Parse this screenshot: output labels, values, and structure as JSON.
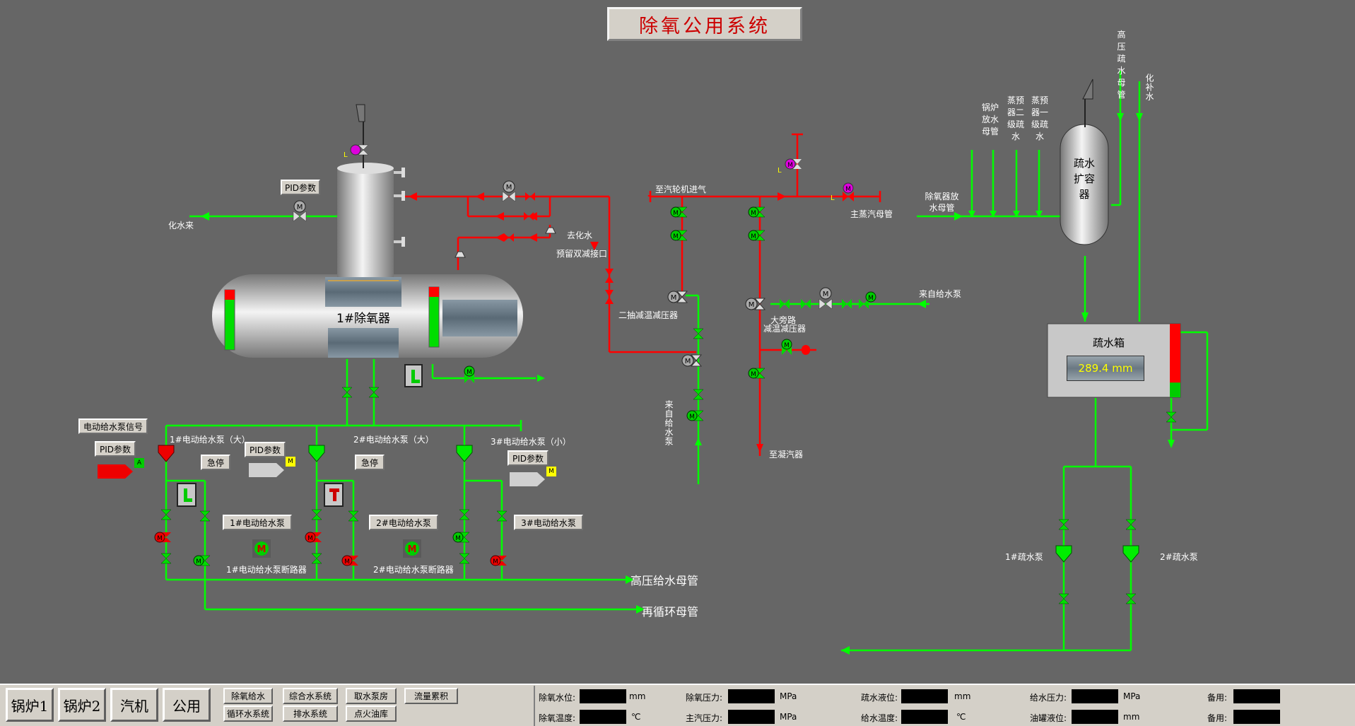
{
  "title": "除氧公用系统",
  "deaerator": {
    "name": "1#除氧器"
  },
  "tank": {
    "name": "疏水箱",
    "level": "289.4 mm"
  },
  "expander": {
    "name": "疏水扩容器"
  },
  "labels": {
    "chem_water_in": "化水来",
    "to_chem_water": "去化水",
    "reserved_port": "预留双减接口",
    "to_turbine_steam": "至汽轮机进气",
    "main_steam_header": "主蒸汽母管",
    "second_extraction": "二抽减温减压器",
    "from_feed_pump_right": "来自给水泵",
    "from_feed_pump_vertical": "来自给水泵",
    "large_bypass_1": "大旁路",
    "large_bypass_2": "减温减压器",
    "to_condenser": "至凝汽器",
    "hp_drain_header": "高压疏水母管",
    "chem_makeup": "化补水",
    "boiler_blowdown": "锅炉放水母管",
    "preheat2": "蒸预器二级疏水",
    "preheat1": "蒸预器一级疏水",
    "deaerator_drain": "除氧器放水母管",
    "pump1_label": "1#电动给水泵（大）",
    "pump2_label": "2#电动给水泵（大）",
    "pump3_label": "3#电动给水泵（小）",
    "breaker1": "1#电动给水泵断路器",
    "breaker2": "2#电动给水泵断路器",
    "hp_feed_header": "高压给水母管",
    "recirc_header": "再循环母管",
    "drain_pump1": "1#疏水泵",
    "drain_pump2": "2#疏水泵",
    "valve_letter": "L"
  },
  "buttons": {
    "pid1": "PID参数",
    "pid_pump1": "PID参数",
    "pid_pump2": "PID参数",
    "pid_pump3": "PID参数",
    "pump_signal": "电动给水泵信号",
    "estop1": "急停",
    "estop2": "急停",
    "pump1": "1#电动给水泵",
    "pump2": "2#电动给水泵",
    "pump3": "3#电动给水泵"
  },
  "nav": {
    "boiler1": "锅炉1",
    "boiler2": "锅炉2",
    "turbine": "汽机",
    "common": "公用",
    "sub": [
      "除氧给水",
      "综合水系统",
      "取水泵房",
      "流量累积",
      "循环水系统",
      "排水系统",
      "点火油库"
    ]
  },
  "data_panel": {
    "row1": [
      {
        "label": "除氧水位:",
        "unit": "mm"
      },
      {
        "label": "除氧压力:",
        "unit": "MPa"
      },
      {
        "label": "疏水液位:",
        "unit": "mm"
      },
      {
        "label": "给水压力:",
        "unit": "MPa"
      },
      {
        "label": "备用:",
        "unit": ""
      }
    ],
    "row2": [
      {
        "label": "除氧温度:",
        "unit": "℃"
      },
      {
        "label": "主汽压力:",
        "unit": "MPa"
      },
      {
        "label": "给水温度:",
        "unit": "℃"
      },
      {
        "label": "油罐液位:",
        "unit": "mm"
      },
      {
        "label": "备用:",
        "unit": ""
      }
    ]
  },
  "colors": {
    "background": "#666666",
    "green_pipe": "#00ff00",
    "red_pipe": "#ff0000",
    "title_text": "#cc0000",
    "readout_text": "#ffff00"
  },
  "tank_level_fraction": 0.8
}
